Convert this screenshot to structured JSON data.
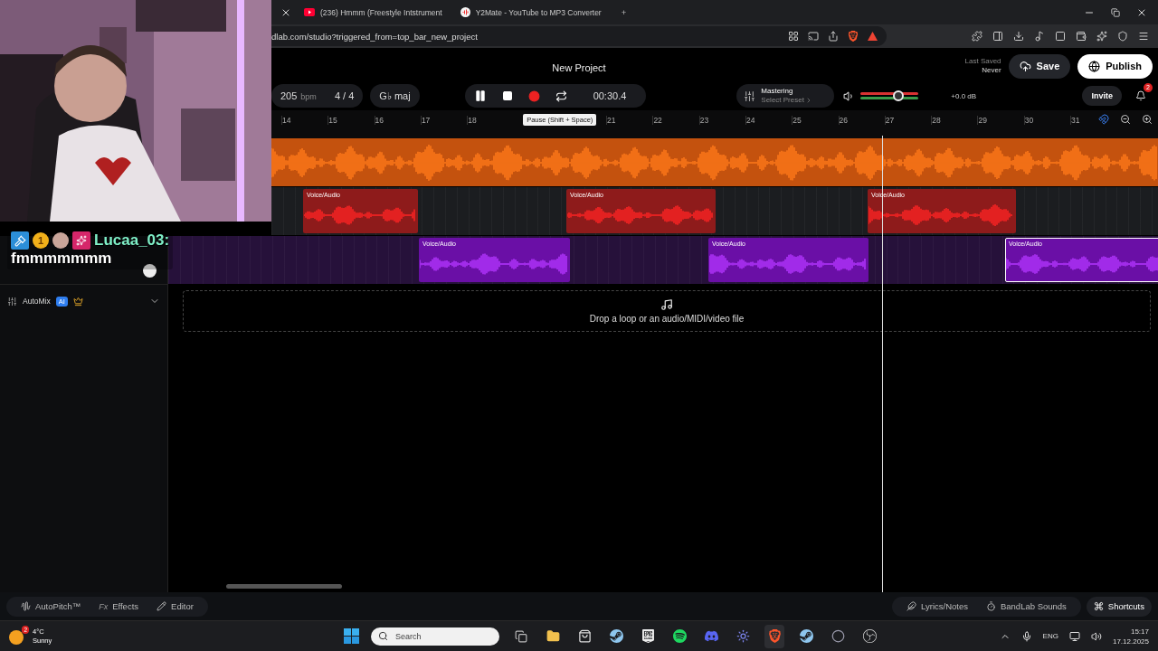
{
  "browser": {
    "tabs": [
      {
        "label": "(236) Hmmm (Freestyle Intstrument",
        "selected": false,
        "kind": "video"
      },
      {
        "label": "Y2Mate - YouTube to MP3 Converter",
        "selected": false,
        "kind": "converter"
      }
    ],
    "new_tab": "+",
    "address": "dlab.com/studio?triggered_from=top_bar_new_project"
  },
  "studio": {
    "title": "New Project",
    "last_saved_label": "Last Saved",
    "last_saved_value": "Never",
    "save": "Save",
    "publish": "Publish",
    "tempo": "205",
    "tempo_unit": "bpm",
    "time_signature": "4 / 4",
    "key": "G♭ maj",
    "playing": true,
    "time": "00:30.4",
    "mastering": {
      "title": "Mastering",
      "preset": "Select Preset"
    },
    "volume": {
      "level": 0.65,
      "reading": "+0.0 dB"
    },
    "invite": "Invite",
    "notifications": "2",
    "tooltip": "Pause (Shift + Space)"
  },
  "ruler": [
    "14",
    "15",
    "16",
    "17",
    "18",
    "21",
    "22",
    "23",
    "24",
    "25",
    "26",
    "27",
    "28",
    "29",
    "30",
    "31"
  ],
  "tracks": [
    {
      "color": "#c4520e"
    },
    {
      "color": "#8e1b1b",
      "clips": [
        {
          "label": "Voice/Audio",
          "selected": false
        },
        {
          "label": "Voice/Audio",
          "selected": false
        },
        {
          "label": "Voice/Audio",
          "selected": false
        }
      ]
    },
    {
      "color": "#6a0fa6",
      "clips": [
        {
          "label": "Voice/Audio",
          "selected": false
        },
        {
          "label": "Voice/Audio",
          "selected": false
        },
        {
          "label": "Voice/Audio",
          "selected": true
        }
      ]
    }
  ],
  "drop_zone": "Drop a loop or an audio/MIDI/video file",
  "automix": {
    "label": "AutoMix",
    "badge": "AI"
  },
  "chat": {
    "badge_count": "1",
    "user": "Lucaa_03:",
    "message": "fmmmmmmm"
  },
  "bottom_tools": [
    {
      "kind": "autopitch",
      "label": "AutoPitch™"
    },
    {
      "kind": "effects",
      "glyph": "Fx",
      "label": "Effects"
    },
    {
      "kind": "editor",
      "label": "Editor"
    }
  ],
  "side_tools": [
    {
      "kind": "lyrics",
      "label": "Lyrics/Notes"
    },
    {
      "kind": "sounds",
      "label": "BandLab Sounds"
    },
    {
      "kind": "shortcuts",
      "label": "Shortcuts"
    }
  ],
  "taskbar": {
    "weather": {
      "badge": "2",
      "temp": "4°C",
      "condition": "Sunny"
    },
    "search": "Search",
    "language": "ENG",
    "time": "15:17",
    "date": "17.12.2025"
  }
}
